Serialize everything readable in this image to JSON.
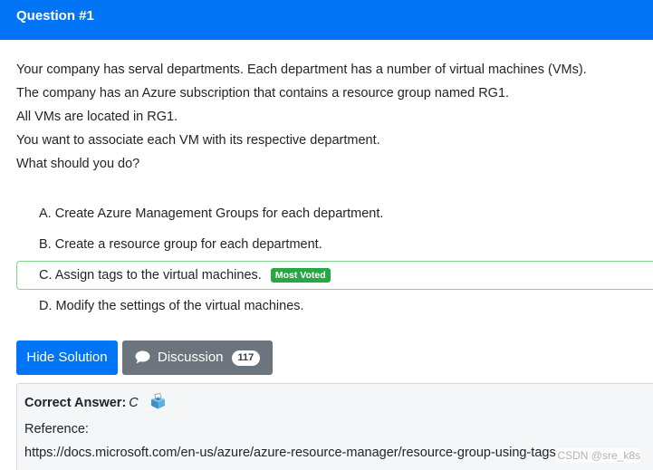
{
  "header": {
    "title": "Question #1"
  },
  "question": {
    "lines": [
      "Your company has serval departments. Each department has a number of virtual machines (VMs).",
      "The company has an Azure subscription that contains a resource group named RG1.",
      "All VMs are located in RG1.",
      "You want to associate each VM with its respective department.",
      "What should you do?"
    ]
  },
  "choices": [
    {
      "text": "A. Create Azure Management Groups for each department."
    },
    {
      "text": "B. Create a resource group for each department."
    },
    {
      "text": "C. Assign tags to the virtual machines.",
      "badge": "Most Voted"
    },
    {
      "text": "D. Modify the settings of the virtual machines."
    }
  ],
  "buttons": {
    "hide_solution": "Hide Solution",
    "discussion": "Discussion",
    "discussion_count": "117"
  },
  "answer": {
    "label": "Correct Answer:",
    "value": "C",
    "reference_label": "Reference:",
    "reference_url": "https://docs.microsoft.com/en-us/azure/azure-resource-manager/resource-group-using-tags"
  },
  "watermark": "CSDN @sre_k8s",
  "colors": {
    "primary": "#0275f7",
    "secondary": "#6c757d",
    "success": "#28a745",
    "voted_border": "#7fd68f"
  }
}
